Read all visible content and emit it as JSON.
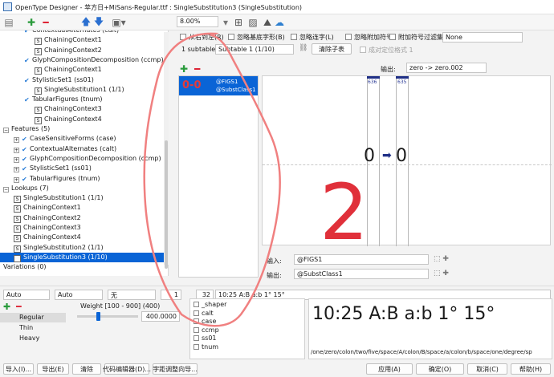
{
  "window": {
    "title": "OpenType Designer - 苹方日+MiSans-Regular.ttf : SingleSubstitution3 (SingleSubstitution)"
  },
  "toolbar": {
    "zoom": "8.00%"
  },
  "tree": {
    "rows": [
      {
        "label": "ContextualAlternates (calt)",
        "indent": 2,
        "kind": "check"
      },
      {
        "label": "ChainingContext1",
        "indent": 3,
        "kind": "s"
      },
      {
        "label": "ChainingContext2",
        "indent": 3,
        "kind": "s"
      },
      {
        "label": "GlyphCompositionDecomposition (ccmp)",
        "indent": 2,
        "kind": "check"
      },
      {
        "label": "ChainingContext1",
        "indent": 3,
        "kind": "s"
      },
      {
        "label": "StylisticSet1 (ss01)",
        "indent": 2,
        "kind": "check"
      },
      {
        "label": "SingleSubstitution1 (1/1)",
        "indent": 3,
        "kind": "s"
      },
      {
        "label": "TabularFigures (tnum)",
        "indent": 2,
        "kind": "check"
      },
      {
        "label": "ChainingContext3",
        "indent": 3,
        "kind": "s"
      },
      {
        "label": "ChainingContext4",
        "indent": 3,
        "kind": "s"
      },
      {
        "label": "Features (5)",
        "indent": 0,
        "kind": "expand-open"
      },
      {
        "label": "CaseSensitiveForms (case)",
        "indent": 1,
        "kind": "expand-check"
      },
      {
        "label": "ContextualAlternates (calt)",
        "indent": 1,
        "kind": "expand-check"
      },
      {
        "label": "GlyphCompositionDecomposition (ccmp)",
        "indent": 1,
        "kind": "expand-check"
      },
      {
        "label": "StylisticSet1 (ss01)",
        "indent": 1,
        "kind": "expand-check"
      },
      {
        "label": "TabularFigures (tnum)",
        "indent": 1,
        "kind": "expand-check"
      },
      {
        "label": "Lookups (7)",
        "indent": 0,
        "kind": "expand-open"
      },
      {
        "label": "SingleSubstitution1 (1/1)",
        "indent": 1,
        "kind": "s"
      },
      {
        "label": "ChainingContext1",
        "indent": 1,
        "kind": "s"
      },
      {
        "label": "ChainingContext2",
        "indent": 1,
        "kind": "s"
      },
      {
        "label": "ChainingContext3",
        "indent": 1,
        "kind": "s"
      },
      {
        "label": "ChainingContext4",
        "indent": 1,
        "kind": "s"
      },
      {
        "label": "SingleSubstitution2 (1/1)",
        "indent": 1,
        "kind": "s"
      },
      {
        "label": "SingleSubstitution3 (1/10)",
        "indent": 1,
        "kind": "s",
        "selected": true
      },
      {
        "label": "Variations (0)",
        "indent": 0,
        "kind": "none"
      }
    ]
  },
  "options": {
    "rtl": "从右到左(R)",
    "ignore_base": "忽略基底字形(B)",
    "ignore_lig": "忽略连字(L)",
    "ignore_mark": "忽略附加符号",
    "mark_filter": "附加符号过滤集",
    "mark_filter_value": "None",
    "subtable_count": "1 subtable",
    "subtable_select": "Subtable 1 (1/10)",
    "clear_subtable": "清除子表",
    "cursive": "成对定位格式 1"
  },
  "rule": {
    "glyph_preview": "0-0",
    "input_class": "@FIGS1",
    "output_class": "@SubstClass1",
    "output_label": "输出:",
    "output_value": "zero -> zero.002",
    "glyph_ids": [
      "636",
      "635"
    ],
    "big_left": "0",
    "big_right": "0"
  },
  "io": {
    "input_label": "输入:",
    "input_value": "@FIGS1",
    "output_label": "输出:",
    "output_value": "@SubstClass1"
  },
  "annotation": {
    "number": "2"
  },
  "preview_controls": {
    "script": "Auto",
    "lang": "Auto",
    "none": "无",
    "count": "1",
    "size": "32",
    "text": "10:25 A:B a:b 1° 15°"
  },
  "weights": {
    "label": "Weight [100 - 900] (400)",
    "value": "400.0000",
    "items": [
      "Regular",
      "Thin",
      "Heavy"
    ]
  },
  "features": {
    "items": [
      "_shaper",
      "calt",
      "case",
      "ccmp",
      "ss01",
      "tnum"
    ]
  },
  "preview": {
    "text": "10:25 A:B a:b 1° 15°",
    "glyphs": "/one/zero/colon/two/five/space/A/colon/B/space/a/colon/b/space/one/degree/sp"
  },
  "bottom_buttons": {
    "import": "导入(I)...",
    "export": "导出(E)",
    "clear": "清除",
    "code_editor": "代码编辑器(D)...",
    "kern_wizard": "字距调整向导...",
    "apply": "应用(A)",
    "ok": "确定(O)",
    "cancel": "取消(C)",
    "help": "帮助(H)"
  },
  "colors": {
    "accent": "#0a64d6",
    "annotation": "#e0303a",
    "stroke": "#f08080"
  }
}
